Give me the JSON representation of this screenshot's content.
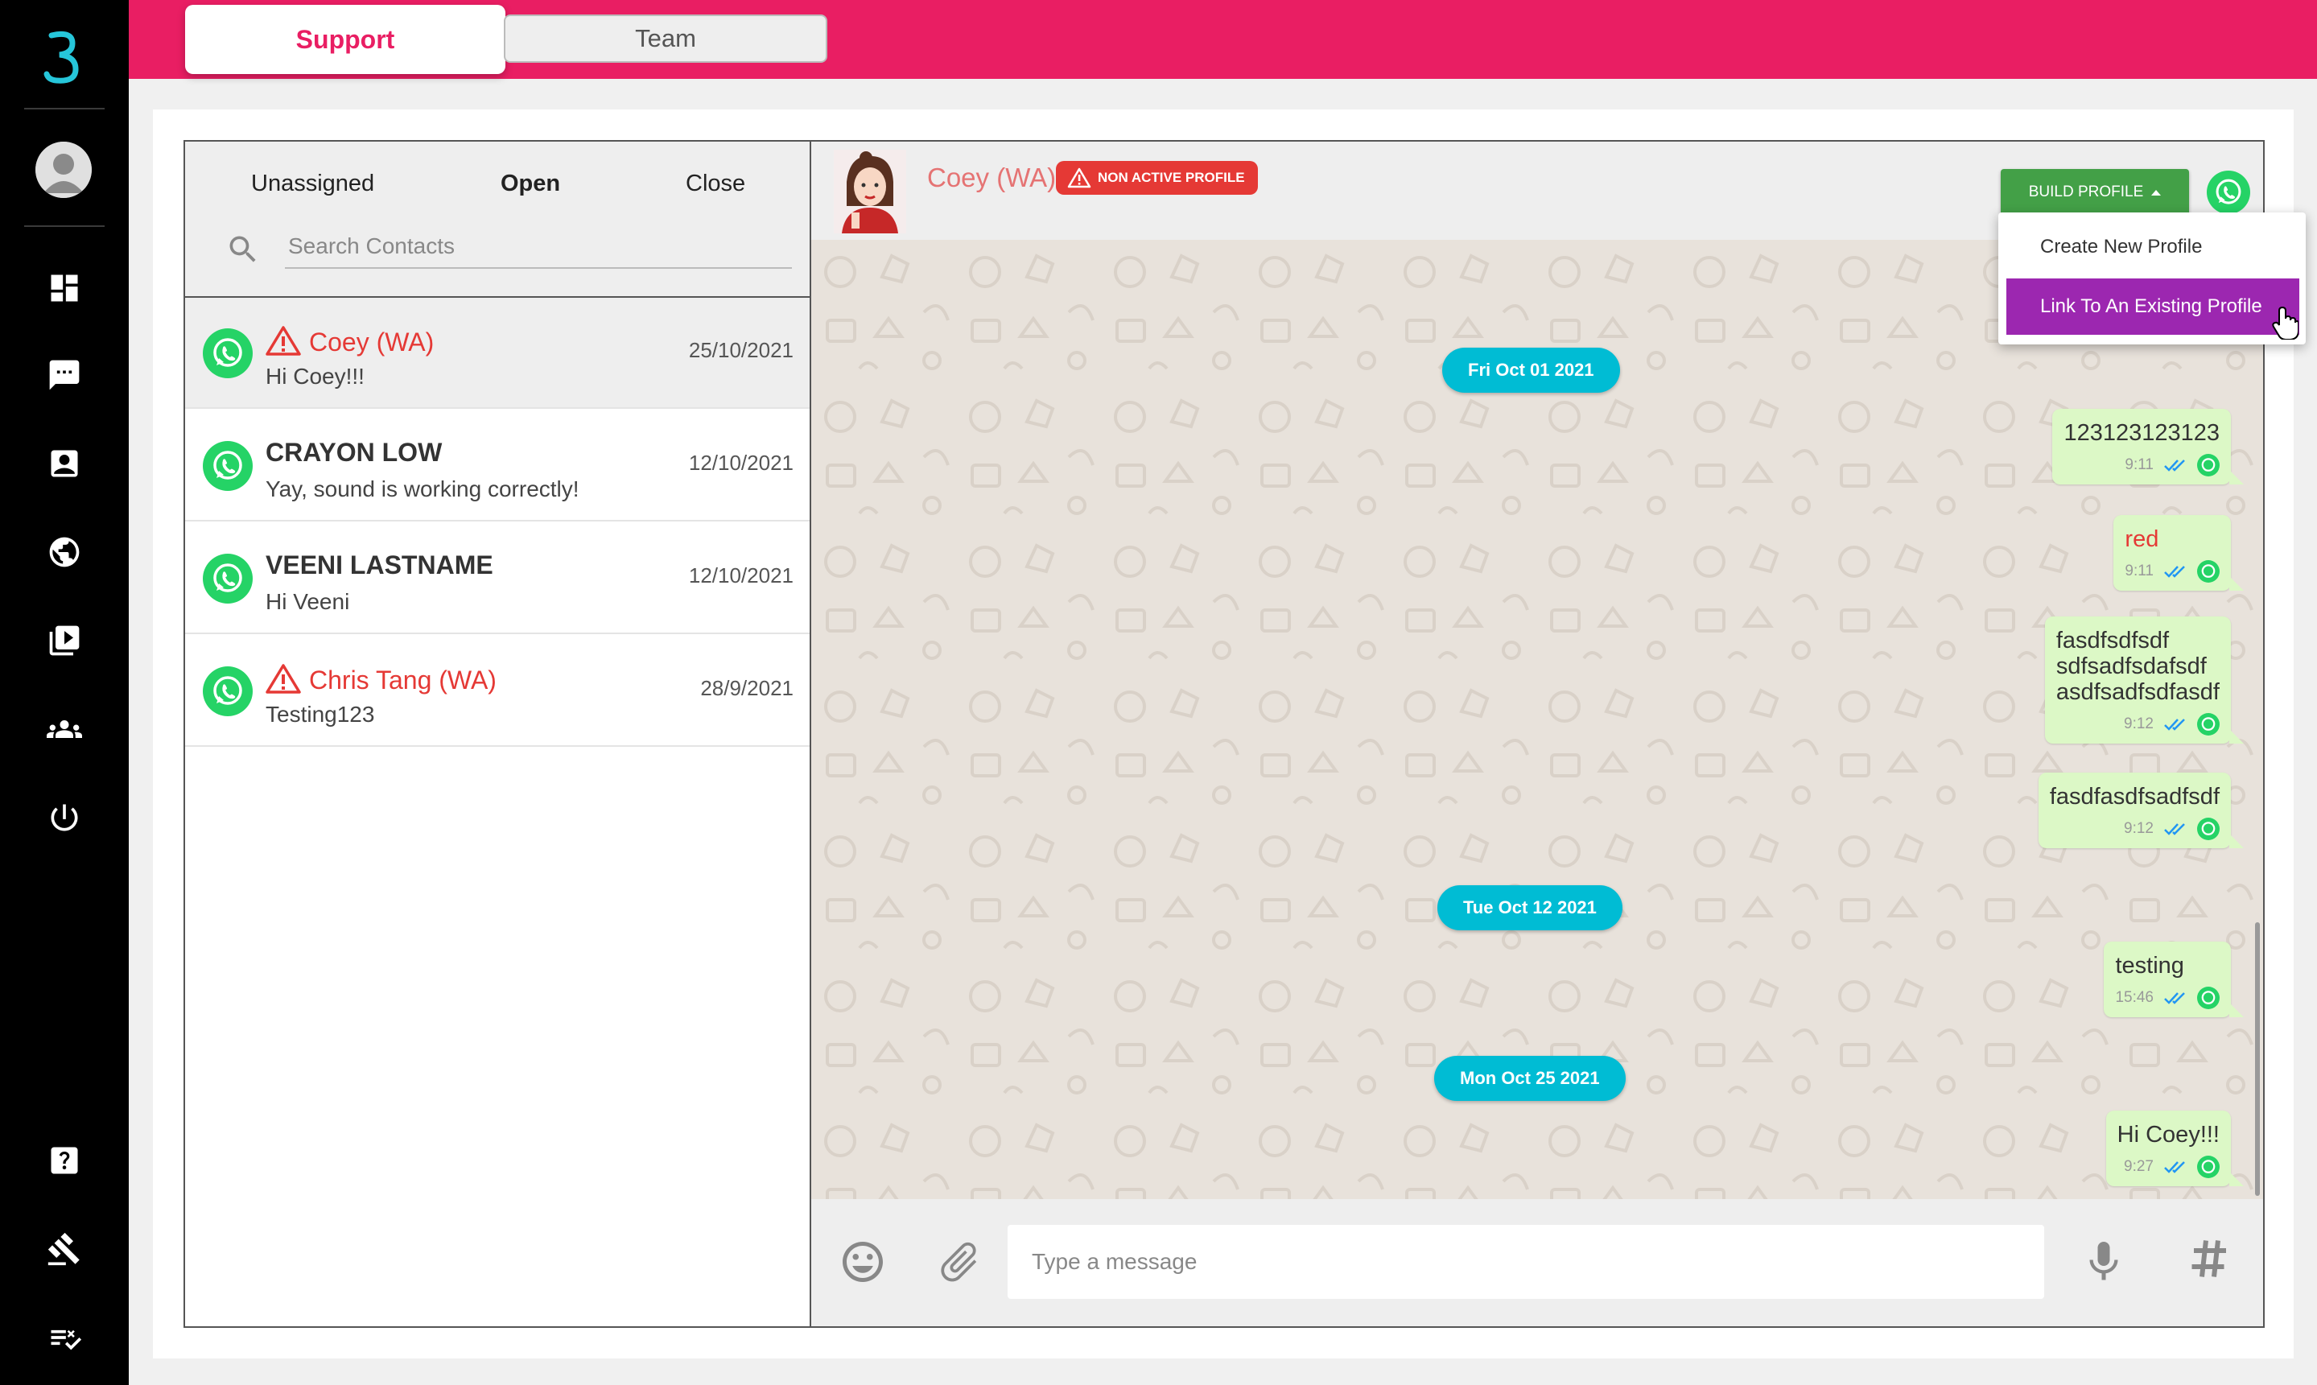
{
  "nav": {
    "items": [
      "dashboard-icon",
      "chat-icon",
      "contacts-icon",
      "globe-icon",
      "media-icon",
      "team-icon",
      "power-icon",
      "help-icon",
      "gavel-icon",
      "checklist-icon"
    ]
  },
  "topbar": {
    "tabs": [
      {
        "label": "Support",
        "active": true
      },
      {
        "label": "Team",
        "active": false
      }
    ],
    "accent": "#e91e63"
  },
  "contacts": {
    "filters": [
      {
        "label": "Unassigned",
        "active": false
      },
      {
        "label": "Open",
        "active": true
      },
      {
        "label": "Close",
        "active": false
      }
    ],
    "search_placeholder": "Search Contacts",
    "list": [
      {
        "name": "Coey (WA)",
        "last_message": "Hi Coey!!!",
        "date": "25/10/2021",
        "warning": true,
        "selected": true
      },
      {
        "name": "CRAYON LOW",
        "last_message": "Yay, sound is working correctly!",
        "date": "12/10/2021",
        "warning": false,
        "selected": false
      },
      {
        "name": "VEENI LASTNAME",
        "last_message": "Hi Veeni",
        "date": "12/10/2021",
        "warning": false,
        "selected": false
      },
      {
        "name": "Chris Tang (WA)",
        "last_message": "Testing123",
        "date": "28/9/2021",
        "warning": true,
        "selected": false
      }
    ]
  },
  "chat": {
    "contact_name": "Coey (WA)",
    "status_badge": "NON ACTIVE PROFILE",
    "build_profile_label": "BUILD PROFILE",
    "dropdown": {
      "items": [
        {
          "label": "Create New Profile",
          "active": false
        },
        {
          "label": "Link To An Existing Profile",
          "active": true
        }
      ]
    },
    "date_chips": [
      "Fri Oct 01 2021",
      "Tue Oct 12 2021",
      "Mon Oct 25 2021"
    ],
    "messages": [
      {
        "text": "123123123123",
        "time": "9:11",
        "red": false
      },
      {
        "text": "red",
        "time": "9:11",
        "red": true
      },
      {
        "text": "fasdfsdfsdf\nsdfsadfsdafsdf\nasdfsadfsdfasdf",
        "time": "9:12",
        "red": false
      },
      {
        "text": "fasdfasdfsadfsdf",
        "time": "9:12",
        "red": false
      },
      {
        "text": "testing",
        "time": "15:46",
        "red": false
      },
      {
        "text": "Hi Coey!!!",
        "time": "9:27",
        "red": false
      }
    ],
    "composer_placeholder": "Type a message",
    "colors": {
      "whatsapp": "#25d366",
      "chip": "#00bcd4",
      "bubble": "#dcf8c6",
      "warning": "#e53935",
      "menu_active": "#9c27b0"
    }
  }
}
